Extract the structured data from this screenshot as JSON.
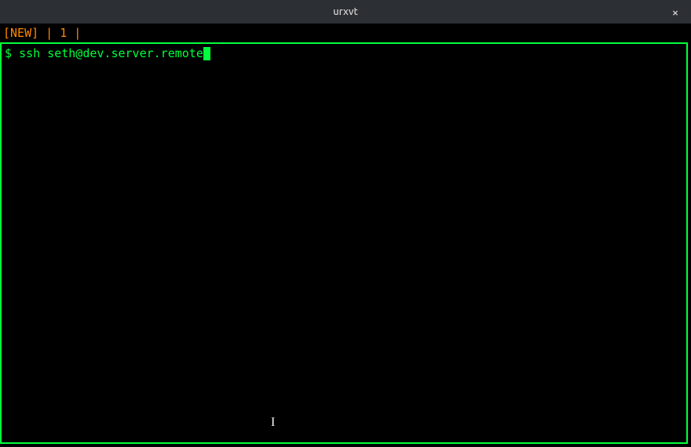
{
  "window": {
    "title": "urxvt"
  },
  "status": {
    "new_label": "[NEW]",
    "sep1": " | ",
    "num": "1",
    "sep2": " |"
  },
  "prompt": {
    "symbol": "$ ",
    "command": "ssh seth@dev.server.remote"
  }
}
